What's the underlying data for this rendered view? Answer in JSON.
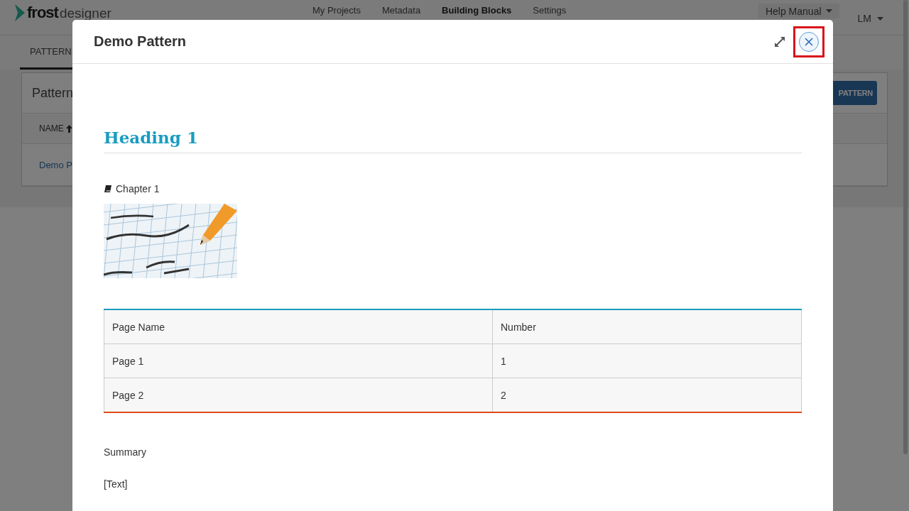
{
  "app": {
    "logo": {
      "brand": "frost",
      "suffix": "designer"
    },
    "nav": [
      {
        "label": "My Projects",
        "selected": false
      },
      {
        "label": "Metadata",
        "selected": false
      },
      {
        "label": "Building Blocks",
        "selected": true
      },
      {
        "label": "Settings",
        "selected": false
      }
    ],
    "help_menu": "Help Manual",
    "user_menu": "LM"
  },
  "tabs": [
    {
      "label": "PATTERN",
      "selected": true
    }
  ],
  "panel": {
    "title": "Pattern",
    "new_button": "PATTERN",
    "column_header": "NAME",
    "rows": [
      "Demo P"
    ]
  },
  "modal": {
    "title": "Demo Pattern",
    "heading": "Heading 1",
    "chapter": "Chapter 1",
    "table": {
      "columns": [
        "Page Name",
        "Number"
      ],
      "rows": [
        [
          "Page 1",
          "1"
        ],
        [
          "Page 2",
          "2"
        ]
      ]
    },
    "paragraphs": [
      "Summary",
      "[Text]"
    ]
  }
}
